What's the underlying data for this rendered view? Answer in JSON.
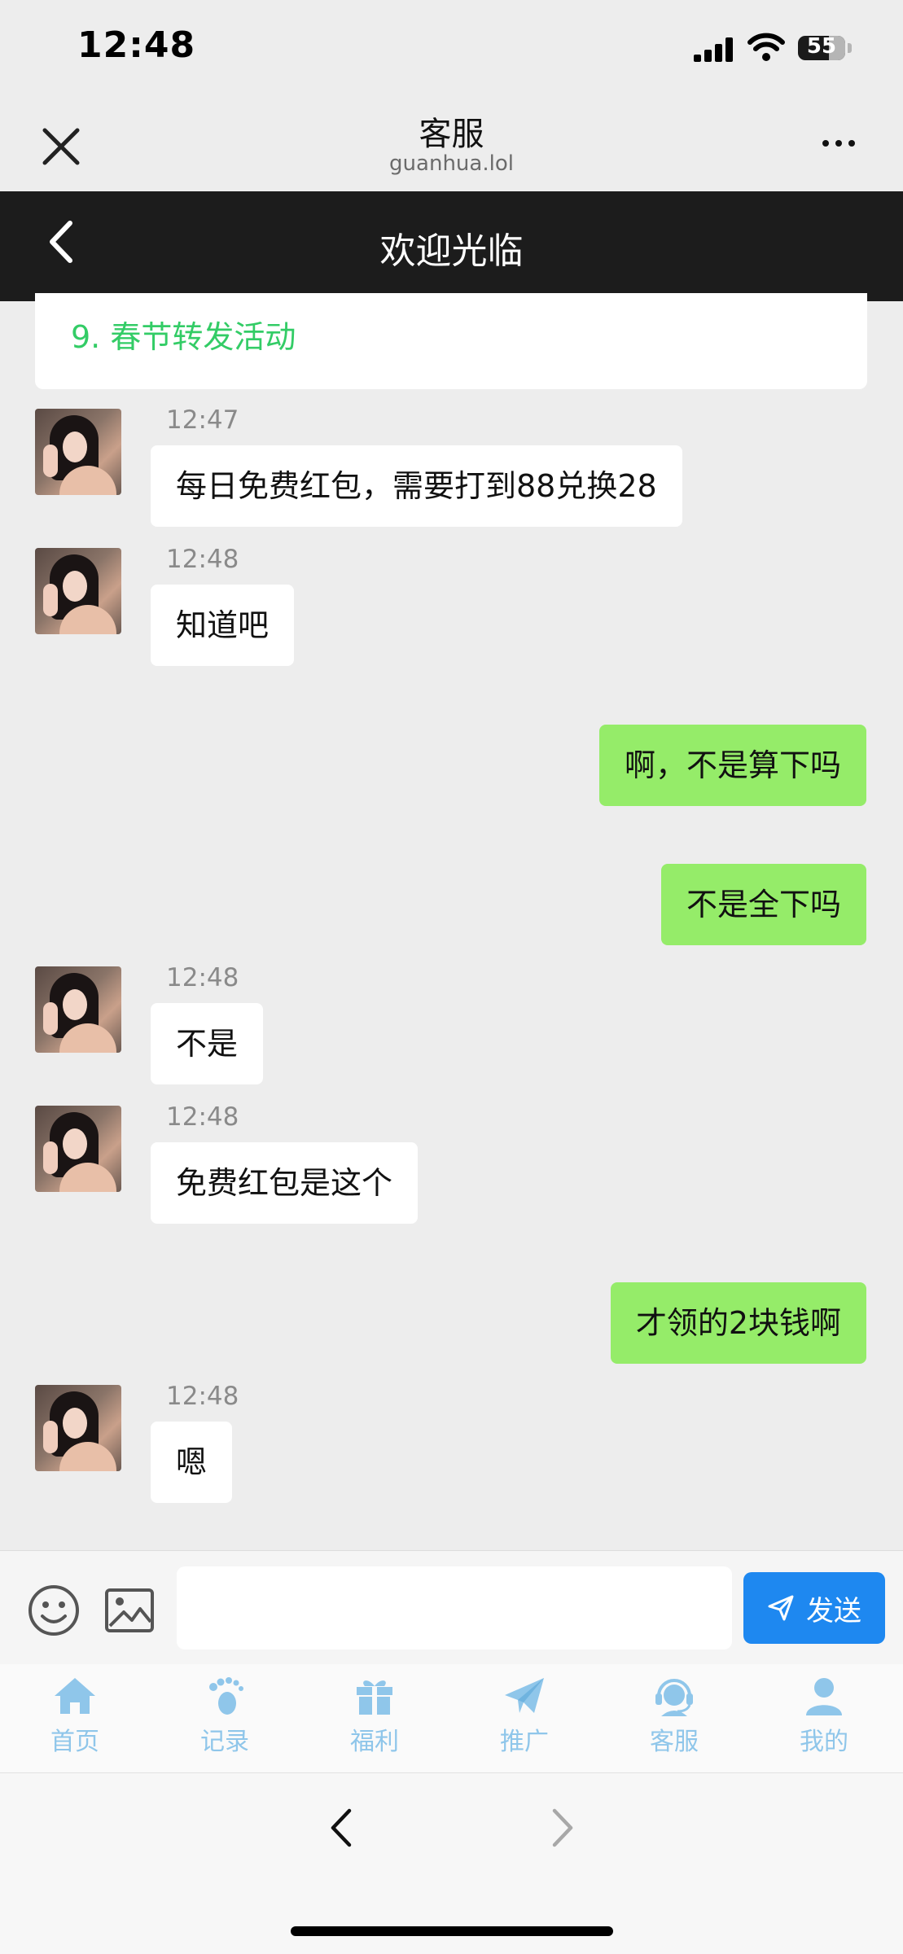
{
  "status_bar": {
    "time": "12:48",
    "battery": "55"
  },
  "browser": {
    "title": "客服",
    "url": "guanhua.lol"
  },
  "header": {
    "title": "欢迎光临"
  },
  "menu_item": "9. 春节转发活动",
  "messages": [
    {
      "side": "left",
      "time": "12:47",
      "text": "每日免费红包，需要打到88兑换28"
    },
    {
      "side": "left",
      "time": "12:48",
      "text": "知道吧"
    },
    {
      "side": "right",
      "text": "啊，不是算下吗"
    },
    {
      "side": "right",
      "text": "不是全下吗"
    },
    {
      "side": "left",
      "time": "12:48",
      "text": "不是"
    },
    {
      "side": "left",
      "time": "12:48",
      "text": "免费红包是这个"
    },
    {
      "side": "right",
      "text": "才领的2块钱啊"
    },
    {
      "side": "left",
      "time": "12:48",
      "text": "嗯"
    }
  ],
  "input": {
    "placeholder": "",
    "value": "",
    "send_label": "发送"
  },
  "tabs": [
    {
      "label": "首页",
      "icon": "home-icon"
    },
    {
      "label": "记录",
      "icon": "footprint-icon"
    },
    {
      "label": "福利",
      "icon": "gift-icon"
    },
    {
      "label": "推广",
      "icon": "paper-plane-icon"
    },
    {
      "label": "客服",
      "icon": "headset-icon"
    },
    {
      "label": "我的",
      "icon": "user-icon"
    }
  ],
  "colors": {
    "sent_bubble": "#95ec69",
    "menu_link": "#33cc66",
    "send_button": "#1e88f0",
    "tab_inactive": "#8fc6ea",
    "header_bg": "#1c1c1c"
  }
}
